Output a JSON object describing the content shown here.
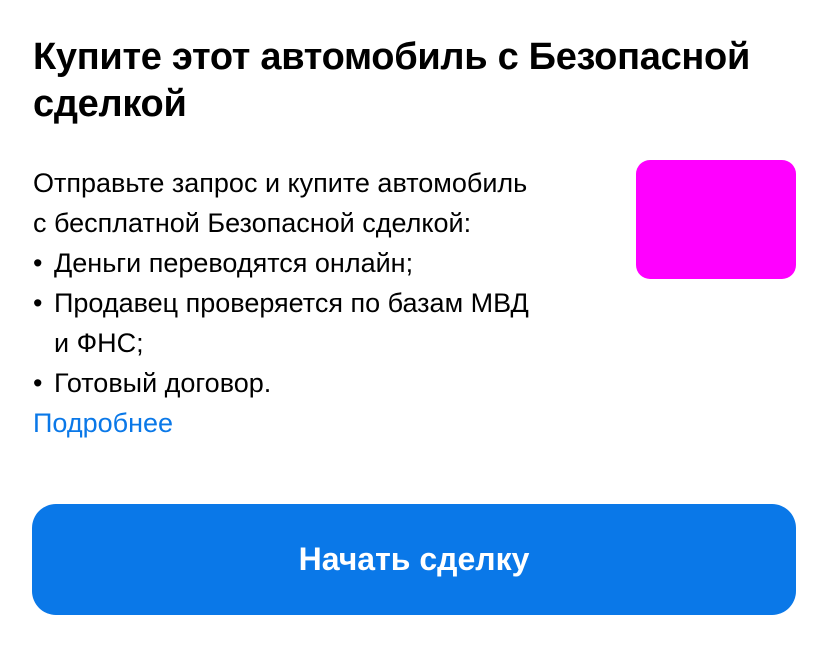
{
  "card": {
    "title": "Купите этот автомобиль с Безопасной сделкой",
    "intro_line1": "Отправьте запрос и купите автомобиль",
    "intro_line2": "с бесплатной Безопасной сделкой:",
    "bullets": [
      {
        "marker": "•",
        "text": "Деньги переводятся онлайн;"
      },
      {
        "marker": "•",
        "text": "Продавец проверяется по базам МВД",
        "text_cont": "и ФНС;"
      },
      {
        "marker": "•",
        "text": "Готовый договор."
      }
    ],
    "more_link": "Подробнее",
    "button_label": "Начать сделку"
  },
  "colors": {
    "accent": "#0a78e8",
    "button_bg": "#0a78e8",
    "thumbnail_placeholder": "#ff00ff",
    "text": "#000000",
    "background": "#ffffff"
  }
}
